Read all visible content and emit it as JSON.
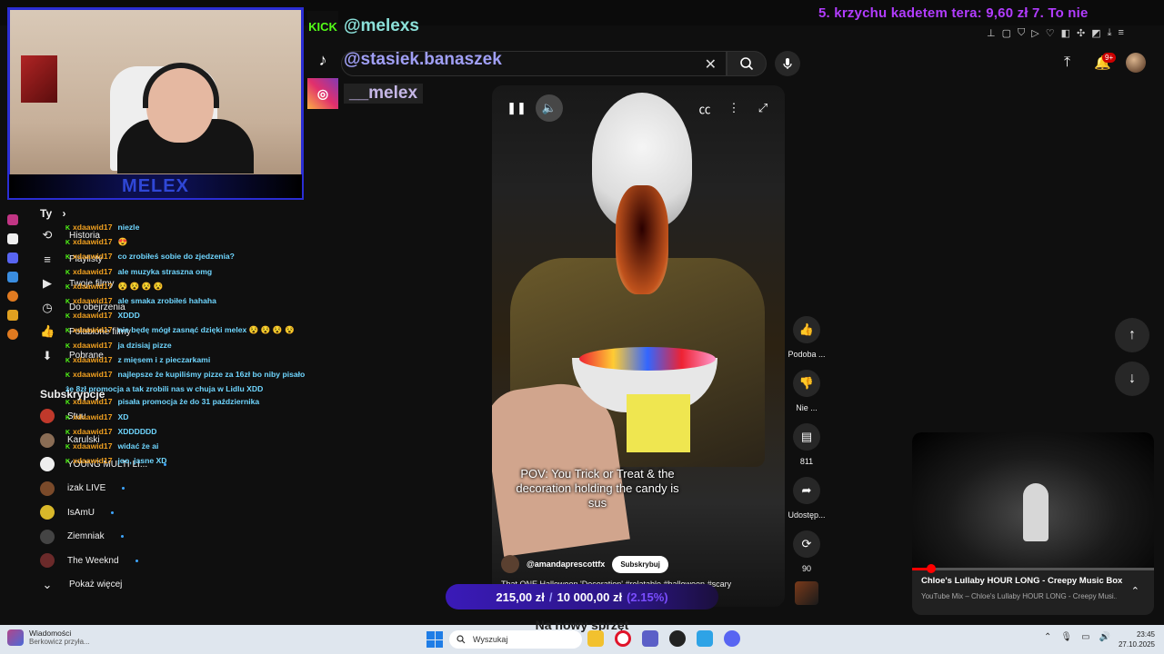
{
  "overlay": {
    "ticker": "5. krzychu kadetem tera: 9,60 zł     7. To nie",
    "webcam_name": "MELEX",
    "socials": {
      "kick_label": "KICK",
      "kick_handle": "@melexs",
      "tiktok_handle": "@stasiek.banaszek",
      "instagram_handle": "__melex"
    },
    "donation": {
      "current": "215,00 zł",
      "separator": "/",
      "goal": "10 000,00 zł",
      "percent": "(2.15%)",
      "title": "Na nowy sprzęt"
    }
  },
  "chat": [
    {
      "user": "xdaawid17",
      "message": "niezle"
    },
    {
      "user": "xdaawid17",
      "message": "😍"
    },
    {
      "user": "xdaawid17",
      "message": "co zrobiłeś sobie do zjedzenia?"
    },
    {
      "user": "xdaawid17",
      "message": "ale muzyka straszna omg"
    },
    {
      "user": "xdaawid17",
      "message": "😵 😵 😵 😵"
    },
    {
      "user": "xdaawid17",
      "message": "ale smaka zrobiłeś hahaha"
    },
    {
      "user": "xdaawid17",
      "message": "XDDD"
    },
    {
      "user": "xdaawid17",
      "message": "nie będę mógł zasnąć dzięki melex 😵 😵 😵 😵"
    },
    {
      "user": "xdaawid17",
      "message": "ja dzisiaj pizze"
    },
    {
      "user": "xdaawid17",
      "message": "z mięsem i z pieczarkami"
    },
    {
      "user": "xdaawid17",
      "message": "najlepsze że kupiliśmy pizze za 16zł bo niby pisało że 8zł promocja a tak zrobili nas w chuja w Lidlu XDD"
    },
    {
      "user": "xdaawid17",
      "message": "pisała promocja że do 31 października"
    },
    {
      "user": "xdaawid17",
      "message": "XD"
    },
    {
      "user": "xdaawid17",
      "message": "XDDDDDD"
    },
    {
      "user": "xdaawid17",
      "message": "widać że ai"
    },
    {
      "user": "xdaawid17",
      "message": "joo, jasne XD"
    }
  ],
  "sidebar": {
    "you_heading": "Ty",
    "you_chevron": "›",
    "you_items": [
      {
        "icon": "history-icon",
        "glyph": "⟲",
        "label": "Historia"
      },
      {
        "icon": "playlist-icon",
        "glyph": "≡",
        "label": "Playlisty"
      },
      {
        "icon": "your-videos-icon",
        "glyph": "▶",
        "label": "Twoje filmy"
      },
      {
        "icon": "watch-later-icon",
        "glyph": "◷",
        "label": "Do obejrzenia"
      },
      {
        "icon": "liked-icon",
        "glyph": "👍",
        "label": "Polubione filmy"
      },
      {
        "icon": "downloads-icon",
        "glyph": "⬇",
        "label": "Pobrane"
      }
    ],
    "subs_heading": "Subskrypcje",
    "subs": [
      {
        "label": "Stuu",
        "color": "#c0392b"
      },
      {
        "label": "Karulski",
        "color": "#8a6d55"
      },
      {
        "label": "YOUNG MULTI LI...",
        "color": "#eeeeee"
      },
      {
        "label": "izak LIVE",
        "color": "#7a4a2a"
      },
      {
        "label": "IsAmU",
        "color": "#d9b82a"
      },
      {
        "label": "Ziemniak",
        "color": "#444444"
      },
      {
        "label": "The Weeknd",
        "color": "#6b2a2a"
      }
    ],
    "show_more": "Pokaż więcej"
  },
  "search": {
    "value": "",
    "clear_glyph": "✕"
  },
  "short": {
    "caption": "POV: You Trick or Treat & the decoration holding the candy is sus",
    "channel": "@amandaprescottfx",
    "subscribe": "Subskrybuj",
    "description": "That ONE Halloween 'Decoration' #relatable #halloween #scary"
  },
  "actions": {
    "like": "Podoba ...",
    "dislike": "Nie ...",
    "comments": "811",
    "share": "Udostęp...",
    "remix": "90"
  },
  "miniplayer": {
    "title": "Chloe's Lullaby HOUR LONG - Creepy Music Box",
    "subtitle": "YouTube Mix – Chloe's Lullaby HOUR LONG - Creepy Musi...",
    "progress": 0.06
  },
  "taskbar": {
    "news_title": "Wiadomości",
    "news_sub": "Berkowicz przyła...",
    "search_placeholder": "Wyszukaj",
    "time": "23:45",
    "date": "27.10.2025",
    "notif_count": "9+"
  }
}
